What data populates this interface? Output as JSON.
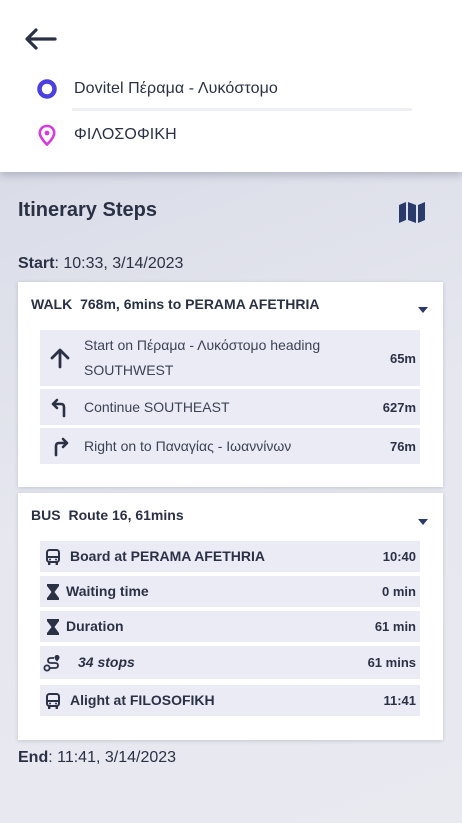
{
  "header": {
    "origin": "Dovitel Πέραμα - Λυκόστομο",
    "destination": "ΦΙΛΟΣΟΦΙΚΗ"
  },
  "title": "Itinerary Steps",
  "start": {
    "label": "Start",
    "value": ": 10:33, 3/14/2023"
  },
  "end": {
    "label": "End",
    "value": ": 11:41, 3/14/2023"
  },
  "legs": [
    {
      "mode": "WALK",
      "summary": "768m, 6mins to PERAMA AFETHRIA",
      "steps": [
        {
          "icon": "arrow-up-icon",
          "text": "Start on Πέραμα - Λυκόστομο heading SOUTHWEST",
          "value": "65m"
        },
        {
          "icon": "turn-left-icon",
          "text": "Continue SOUTHEAST",
          "value": "627m"
        },
        {
          "icon": "turn-right-icon",
          "text": "Right on to Παναγίας - Ιωαννίνων",
          "value": "76m"
        }
      ]
    },
    {
      "mode": "BUS",
      "summary": "Route 16, 61mins",
      "steps": [
        {
          "icon": "bus-icon",
          "text": "Board at PERAMA AFETHRIA",
          "value": "10:40"
        },
        {
          "icon": "hourglass-icon",
          "text": "Waiting time",
          "value": "0 min"
        },
        {
          "icon": "hourglass-icon",
          "text": "Duration",
          "value": "61 min"
        },
        {
          "icon": "route-stops-icon",
          "text": "34 stops",
          "value": "61 mins"
        },
        {
          "icon": "bus-icon",
          "text": "Alight at FILOSOFIKH",
          "value": "11:41"
        }
      ]
    }
  ],
  "colors": {
    "origin": "#4a3fe0",
    "destination": "#d63be0",
    "text": "#2b3145",
    "stepBg": "#ebebf5"
  }
}
